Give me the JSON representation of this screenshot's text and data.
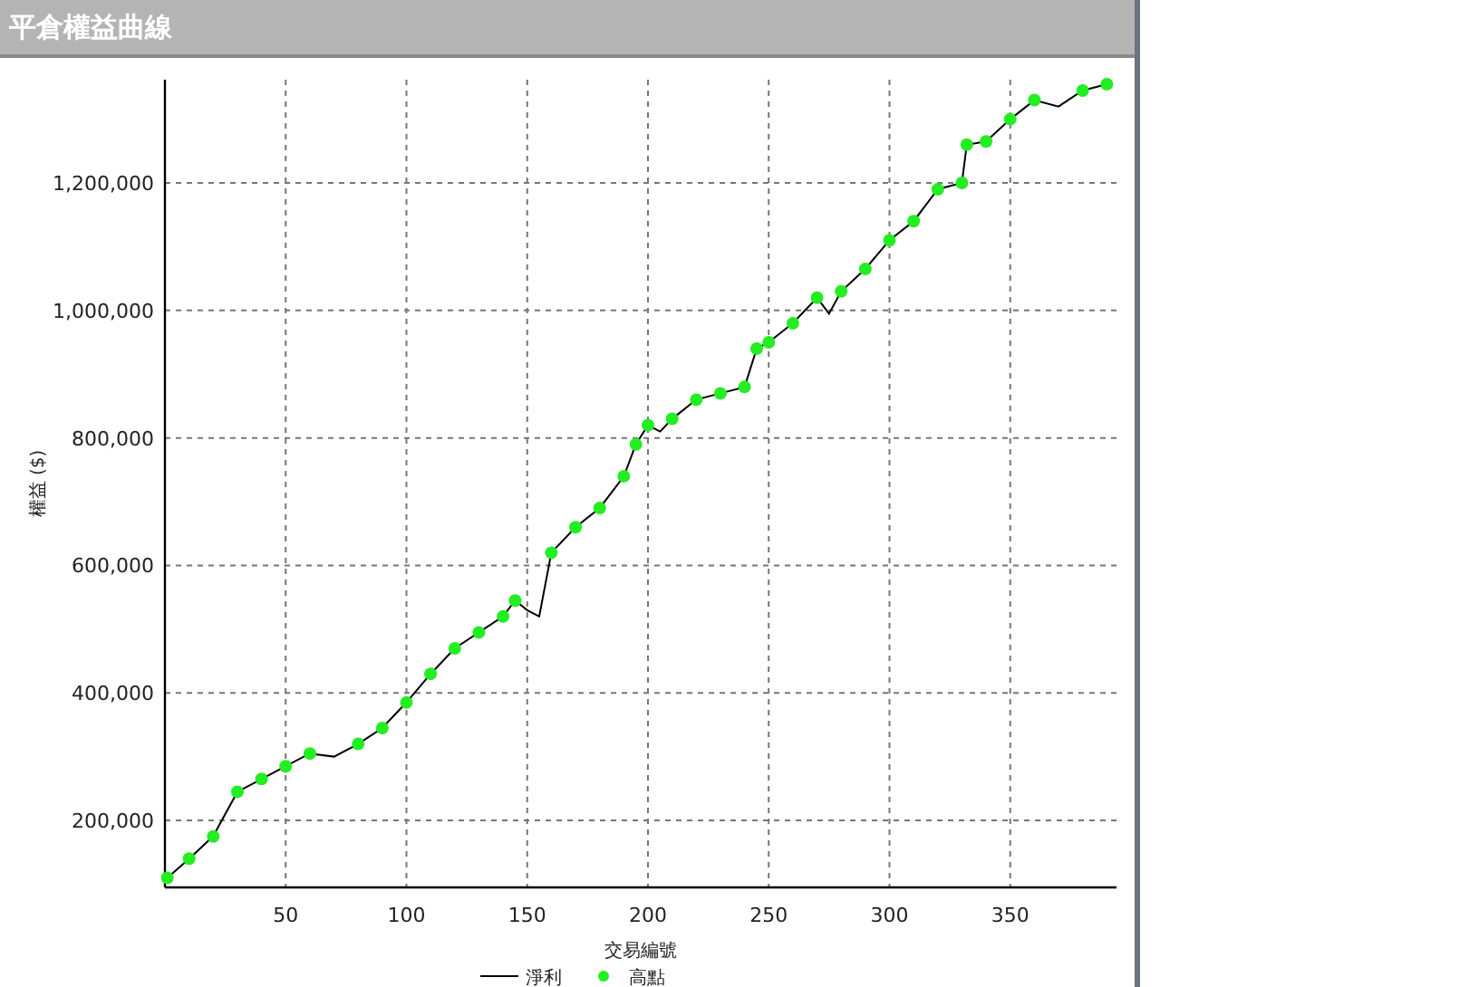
{
  "header": {
    "title": "平倉權益曲線"
  },
  "chart_data": {
    "type": "line",
    "grid": true,
    "legend": "bottom",
    "xlabel": "交易編號",
    "ylabel": "權益 ($)",
    "xlim": [
      0,
      394
    ],
    "ylim": [
      95000,
      1362000
    ],
    "xticks": [
      50,
      100,
      150,
      200,
      250,
      300,
      350
    ],
    "yticks": [
      {
        "value": 200000,
        "label": "200,000"
      },
      {
        "value": 400000,
        "label": "400,000"
      },
      {
        "value": 600000,
        "label": "600,000"
      },
      {
        "value": 800000,
        "label": "800,000"
      },
      {
        "value": 1000000,
        "label": "1,000,000"
      },
      {
        "value": 1200000,
        "label": "1,200,000"
      }
    ],
    "x": [
      1,
      10,
      20,
      30,
      40,
      50,
      60,
      70,
      80,
      90,
      100,
      110,
      120,
      130,
      140,
      145,
      150,
      155,
      160,
      170,
      180,
      190,
      195,
      200,
      205,
      210,
      220,
      230,
      240,
      245,
      250,
      260,
      270,
      275,
      280,
      290,
      300,
      310,
      320,
      330,
      332,
      340,
      350,
      360,
      370,
      380,
      390
    ],
    "series": [
      {
        "name": "淨利",
        "type": "line",
        "marker": "none",
        "color": "#000000",
        "values": [
          110000,
          140000,
          175000,
          245000,
          265000,
          285000,
          305000,
          300000,
          320000,
          345000,
          385000,
          430000,
          470000,
          495000,
          520000,
          545000,
          530000,
          520000,
          620000,
          660000,
          690000,
          740000,
          790000,
          820000,
          810000,
          830000,
          860000,
          870000,
          880000,
          940000,
          950000,
          980000,
          1020000,
          995000,
          1030000,
          1065000,
          1110000,
          1140000,
          1190000,
          1200000,
          1260000,
          1265000,
          1300000,
          1330000,
          1320000,
          1345000,
          1355000
        ]
      },
      {
        "name": "高點",
        "type": "scatter",
        "marker": "circle",
        "color": "#22ee22",
        "values": [
          110000,
          140000,
          175000,
          245000,
          265000,
          285000,
          305000,
          null,
          320000,
          345000,
          385000,
          430000,
          470000,
          495000,
          520000,
          545000,
          null,
          null,
          620000,
          660000,
          690000,
          740000,
          790000,
          820000,
          null,
          830000,
          860000,
          870000,
          880000,
          940000,
          950000,
          980000,
          1020000,
          null,
          1030000,
          1065000,
          1110000,
          1140000,
          1190000,
          1200000,
          1260000,
          1265000,
          1300000,
          1330000,
          null,
          1345000,
          1355000
        ]
      }
    ]
  }
}
